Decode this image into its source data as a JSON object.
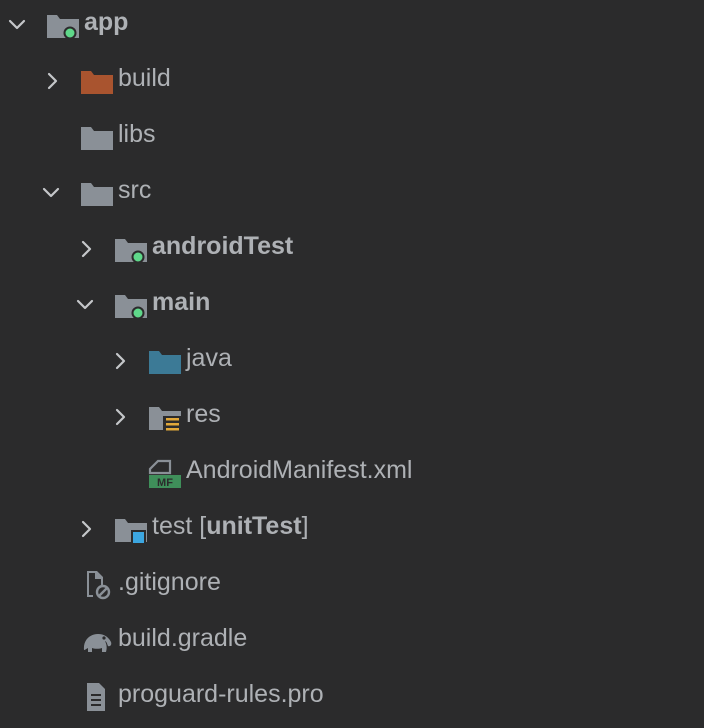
{
  "project_tree": {
    "app": "app",
    "build": "build",
    "libs": "libs",
    "src": "src",
    "androidTest": "androidTest",
    "main": "main",
    "java": "java",
    "res": "res",
    "manifest": "AndroidManifest.xml",
    "manifest_badge": "MF",
    "test": {
      "name": "test",
      "bracket_open": " [",
      "tag": "unitTest",
      "bracket_close": "]"
    },
    "gitignore": ".gitignore",
    "gradle": "build.gradle",
    "proguard": "proguard-rules.pro"
  },
  "colors": {
    "background": "#2b2b2c",
    "text": "#aeb1b5",
    "folder": "#8a9097",
    "excluded_folder": "#a9542f",
    "source_folder": "#3c7a96",
    "module_dot": "#5fd88a",
    "test_square": "#3ca6e0",
    "resource_lines": "#e1a83a",
    "manifest_badge": "#3f8f5a"
  }
}
